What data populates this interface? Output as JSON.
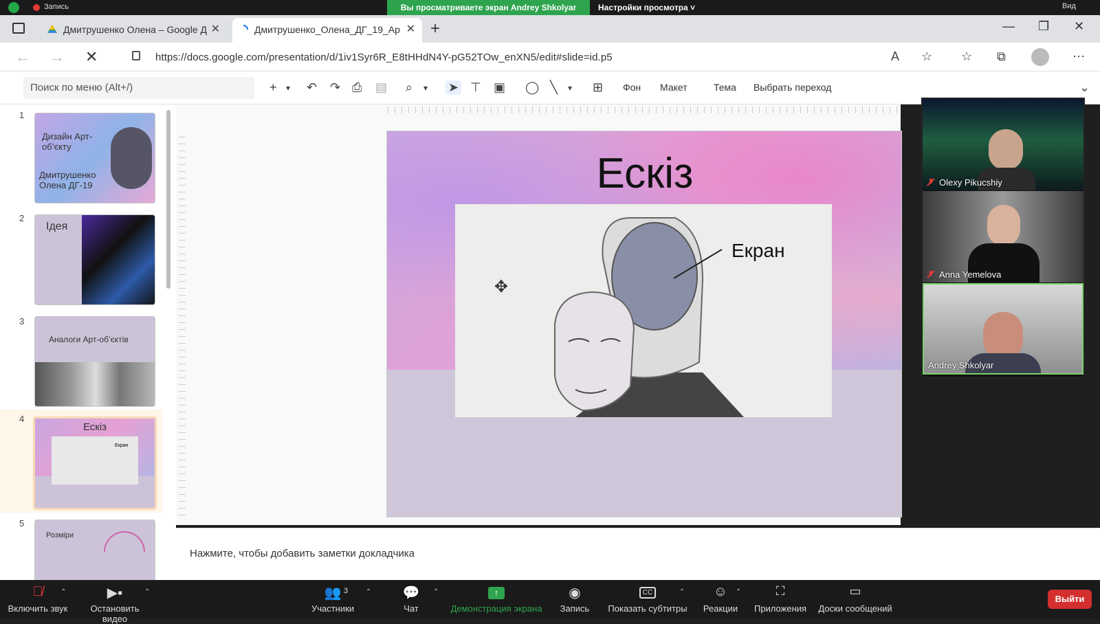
{
  "zoom_top": {
    "recording_label": "Запись",
    "banner": "Вы просматриваете экран Andrey Shkolyar",
    "view_settings": "Настройки просмотра ˅",
    "view": "Вид"
  },
  "browser": {
    "tabs": [
      {
        "title": "Дмитрушенко Олена – Google Д"
      },
      {
        "title": "Дмитрушенко_Олена_ДГ_19_Ар"
      }
    ],
    "url": "https://docs.google.com/presentation/d/1iv1Syr6R_E8tHHdN4Y-pG52TOw_enXN5/edit#slide=id.p5"
  },
  "slides_toolbar": {
    "menu_search_placeholder": "Поиск по меню (Alt+/)",
    "background": "Фон",
    "layout": "Макет",
    "theme": "Тема",
    "transition": "Выбрать переход"
  },
  "filmstrip": {
    "slides": [
      {
        "num": "1",
        "title": "Дизайн Арт-об’єкту",
        "subtitle": "Дмитрушенко Олена ДГ-19"
      },
      {
        "num": "2",
        "title": "Ідея"
      },
      {
        "num": "3",
        "title": "Аналоги Арт-об’єктів"
      },
      {
        "num": "4",
        "title": "Ескіз",
        "label": "Екран"
      },
      {
        "num": "5",
        "title": "Розміри"
      }
    ]
  },
  "slide": {
    "title": "Ескіз",
    "screen_label": "Екран"
  },
  "notes": {
    "placeholder": "Нажмите, чтобы добавить заметки докладчика"
  },
  "participants": [
    {
      "name": "Olexy Pikucshiy"
    },
    {
      "name": "Anna Yemelova"
    },
    {
      "name": "Andrey Shkolyar"
    }
  ],
  "zoom_bar": {
    "unmute": "Включить звук",
    "stop_video": "Остановить видео",
    "participants": "Участники",
    "participants_count": "3",
    "chat": "Чат",
    "share_screen": "Демонстрация экрана",
    "record": "Запись",
    "captions": "Показать субтитры",
    "reactions": "Реакции",
    "apps": "Приложения",
    "whiteboards": "Доски сообщений",
    "leave": "Выйти"
  }
}
